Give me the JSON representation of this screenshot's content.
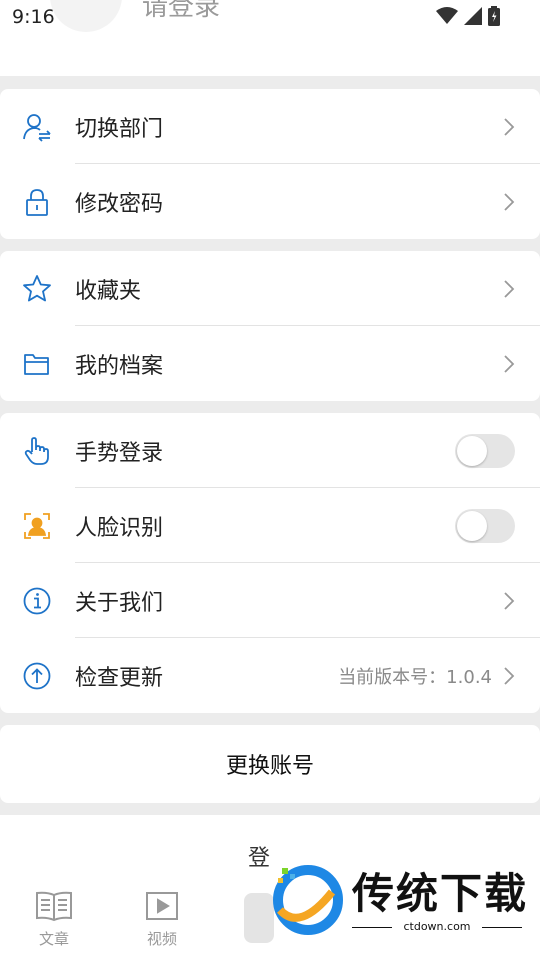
{
  "status": {
    "time": "9:16"
  },
  "header": {
    "login_prompt": "请登录"
  },
  "group1": [
    {
      "label": "切换部门",
      "icon": "switch-user-icon"
    },
    {
      "label": "修改密码",
      "icon": "lock-icon"
    }
  ],
  "group2": [
    {
      "label": "收藏夹",
      "icon": "star-icon"
    },
    {
      "label": "我的档案",
      "icon": "folder-icon"
    }
  ],
  "group3": {
    "gesture": {
      "label": "手势登录",
      "icon": "hand-pointer-icon",
      "enabled": false
    },
    "face": {
      "label": "人脸识别",
      "icon": "face-scan-icon",
      "enabled": false
    },
    "about": {
      "label": "关于我们",
      "icon": "info-icon"
    },
    "update": {
      "label": "检查更新",
      "icon": "upload-icon",
      "version_text": "当前版本号：1.0.4"
    }
  },
  "switch_account": "更换账号",
  "bottom_nav": {
    "tabs": [
      {
        "label": "文章",
        "icon": "book-icon"
      },
      {
        "label": "视频",
        "icon": "play-icon"
      }
    ],
    "partial_glyph": "登"
  },
  "watermark": {
    "title": "传统下载",
    "site": "ctdown.com"
  },
  "colors": {
    "accent": "#1e73c8",
    "face_icon": "#f0a020"
  }
}
